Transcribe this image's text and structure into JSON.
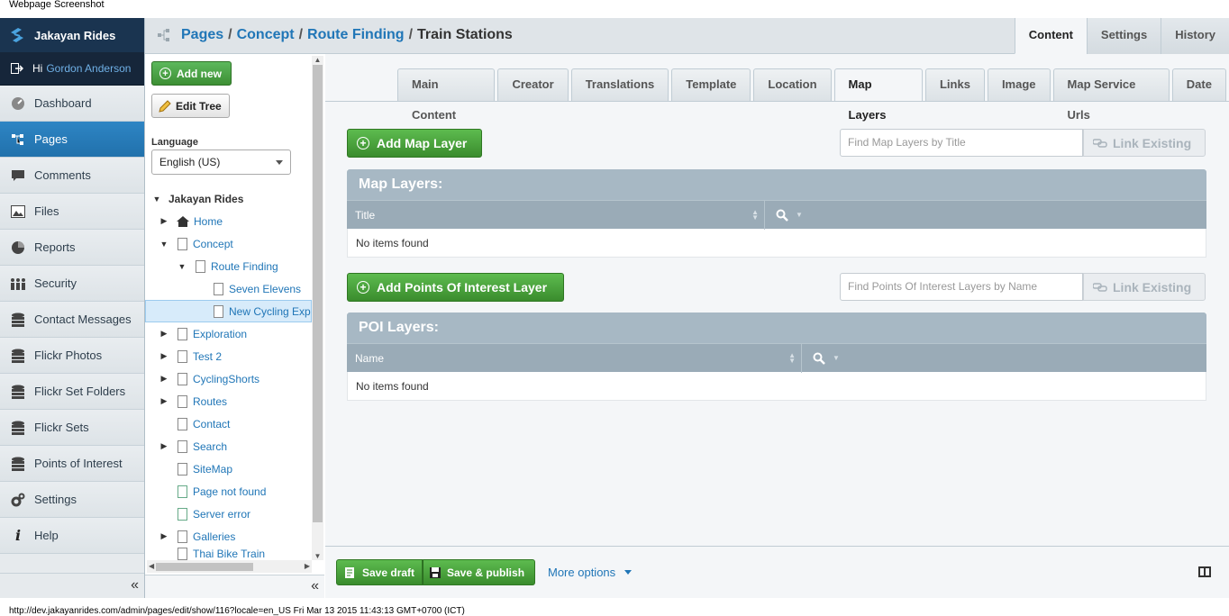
{
  "caption": {
    "top": "Webpage Screenshot",
    "bottom": "http://dev.jakayanrides.com/admin/pages/edit/show/116?locale=en_US Fri Mar 13 2015 11:43:13 GMT+0700 (ICT)"
  },
  "brand": {
    "name": "Jakayan Rides",
    "icon": "logo-icon"
  },
  "user": {
    "greeting": "Hi",
    "name": "Gordon Anderson"
  },
  "menu": {
    "items": [
      {
        "label": "Dashboard",
        "icon": "dashboard-icon"
      },
      {
        "label": "Pages",
        "icon": "sitetree-icon",
        "active": true
      },
      {
        "label": "Comments",
        "icon": "comment-icon"
      },
      {
        "label": "Files",
        "icon": "image-icon"
      },
      {
        "label": "Reports",
        "icon": "pie-chart-icon"
      },
      {
        "label": "Security",
        "icon": "users-icon"
      },
      {
        "label": "Contact Messages",
        "icon": "database-icon"
      },
      {
        "label": "Flickr Photos",
        "icon": "database-icon"
      },
      {
        "label": "Flickr Set Folders",
        "icon": "database-icon"
      },
      {
        "label": "Flickr Sets",
        "icon": "database-icon"
      },
      {
        "label": "Points of Interest",
        "icon": "database-icon"
      },
      {
        "label": "Settings",
        "icon": "gear-icon"
      },
      {
        "label": "Help",
        "icon": "info-icon"
      }
    ],
    "collapse": "«"
  },
  "breadcrumb": {
    "items": [
      "Pages",
      "Concept",
      "Route Finding"
    ],
    "separator": "/",
    "current": "Train Stations"
  },
  "toptabs": [
    "Content",
    "Settings",
    "History"
  ],
  "tree_panel": {
    "add_new": "Add new",
    "edit_tree": "Edit Tree",
    "language_label": "Language",
    "language_value": "English (US)",
    "collapse": "«",
    "nodes": [
      {
        "label": "Jakayan Rides"
      },
      {
        "label": "Home"
      },
      {
        "label": "Concept"
      },
      {
        "label": "Route Finding"
      },
      {
        "label": "Seven Elevens"
      },
      {
        "label": "New Cycling Exp"
      },
      {
        "label": "Exploration"
      },
      {
        "label": "Test 2"
      },
      {
        "label": "CyclingShorts"
      },
      {
        "label": "Routes"
      },
      {
        "label": "Contact"
      },
      {
        "label": "Search"
      },
      {
        "label": "SiteMap"
      },
      {
        "label": "Page not found"
      },
      {
        "label": "Server error"
      },
      {
        "label": "Galleries"
      },
      {
        "label": "Thai Bike Train"
      }
    ]
  },
  "content_tabs": [
    "Main Content",
    "Creator",
    "Translations",
    "Template",
    "Location",
    "Map Layers",
    "Links",
    "Image",
    "Map Service Urls",
    "Date"
  ],
  "active_content_tab": "Map Layers",
  "map_layers": {
    "add_button": "Add Map Layer",
    "search_placeholder": "Find Map Layers by Title",
    "link_existing": "Link Existing",
    "grid_title": "Map Layers:",
    "column": "Title",
    "empty": "No items found"
  },
  "poi_layers": {
    "add_button": "Add Points Of Interest Layer",
    "search_placeholder": "Find Points Of Interest Layers by Name",
    "link_existing": "Link Existing",
    "grid_title": "POI Layers:",
    "column": "Name",
    "empty": "No items found"
  },
  "actions": {
    "save_draft": "Save draft",
    "save_publish": "Save & publish",
    "more_options": "More options"
  },
  "colors": {
    "brand_bg": "#1a3450",
    "active_menu": "#2171ac",
    "link": "#2076b7",
    "green_button": "#3d8f34",
    "grid_header": "#a7b8c4"
  }
}
